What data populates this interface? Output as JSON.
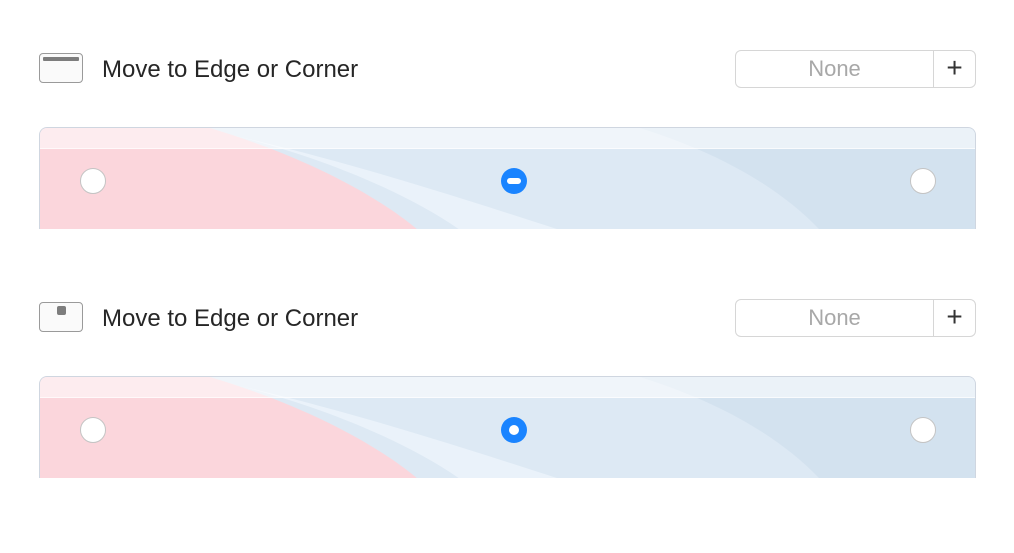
{
  "sections": [
    {
      "icon": "window-top-edge-icon",
      "title": "Move to Edge or Corner",
      "shortcut": {
        "value": "None",
        "add_label": "+"
      },
      "positions": [
        {
          "name": "left",
          "state": "off"
        },
        {
          "name": "center",
          "state": "mixed"
        },
        {
          "name": "right",
          "state": "off"
        }
      ]
    },
    {
      "icon": "window-corner-square-icon",
      "title": "Move to Edge or Corner",
      "shortcut": {
        "value": "None",
        "add_label": "+"
      },
      "positions": [
        {
          "name": "left",
          "state": "off"
        },
        {
          "name": "center",
          "state": "selected"
        },
        {
          "name": "right",
          "state": "off"
        }
      ]
    }
  ],
  "colors": {
    "accent": "#1a84ff",
    "wallpaper_pink": "#fbd6dc",
    "wallpaper_blue": "#d4e1ee"
  }
}
